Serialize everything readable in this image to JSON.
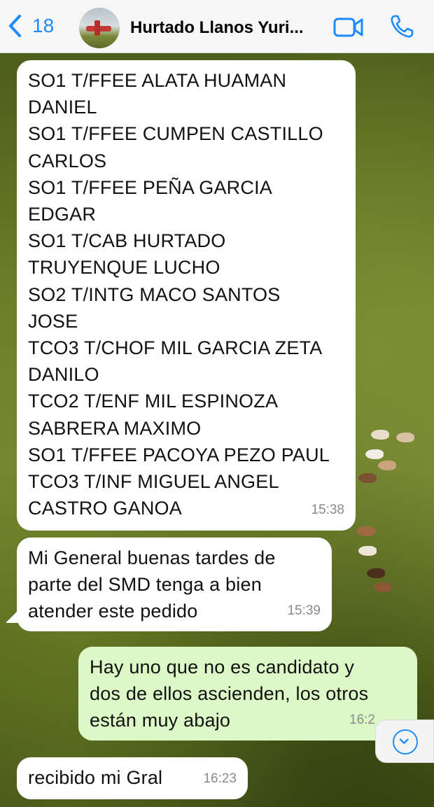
{
  "header": {
    "back_count": "18",
    "contact_name": "Hurtado Llanos Yuri..."
  },
  "messages": [
    {
      "direction": "incoming",
      "lines": [
        "SO1 T/FFEE ALATA HUAMAN",
        "DANIEL",
        "SO1 T/FFEE CUMPEN CASTILLO",
        "CARLOS",
        "SO1 T/FFEE PEÑA GARCIA",
        "EDGAR",
        "SO1 T/CAB HURTADO",
        "TRUYENQUE LUCHO",
        "SO2 T/INTG MACO SANTOS",
        "JOSE",
        "TCO3 T/CHOF MIL GARCIA ZETA",
        "DANILO",
        "TCO2 T/ENF MIL ESPINOZA",
        "SABRERA MAXIMO",
        "SO1 T/FFEE PACOYA PEZO PAUL",
        "TCO3 T/INF MIGUEL ANGEL",
        "CASTRO GANOA"
      ],
      "time": "15:38"
    },
    {
      "direction": "incoming",
      "lines": [
        "Mi General buenas tardes de",
        "parte del SMD tenga a bien",
        "atender este pedido"
      ],
      "time": "15:39"
    },
    {
      "direction": "outgoing",
      "lines": [
        "Hay uno que no es candidato y",
        "dos de ellos ascienden, los otros",
        "están muy abajo"
      ],
      "time": "16:2"
    },
    {
      "direction": "incoming",
      "lines": [
        "recibido mi Gral"
      ],
      "time": "16:23"
    }
  ],
  "icons": {
    "back": "chevron-left-icon",
    "video_call": "video-camera-icon",
    "voice_call": "phone-icon",
    "scroll_down": "chevron-down-circle-icon"
  },
  "colors": {
    "accent": "#1a8cff",
    "incoming_bubble": "#ffffff",
    "outgoing_bubble": "#dbf8c6",
    "timestamp": "#8a8a8a"
  }
}
